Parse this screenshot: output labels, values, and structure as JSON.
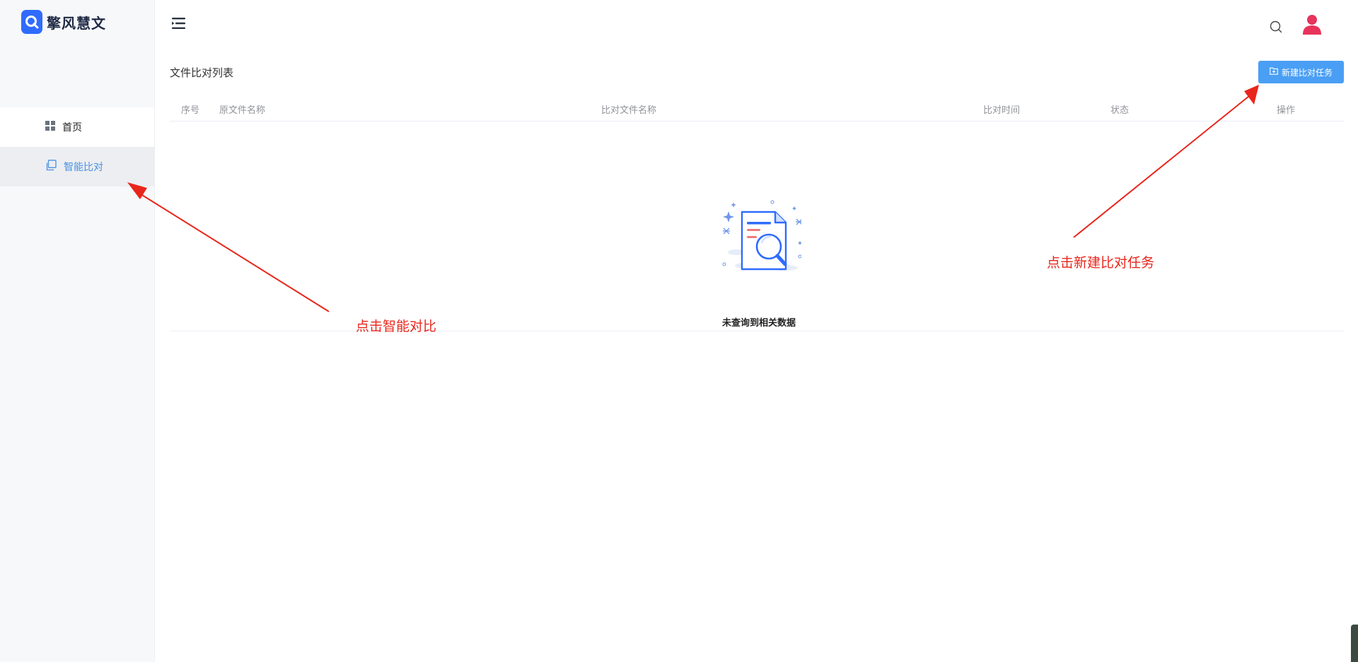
{
  "brand": {
    "name": "擎风慧文"
  },
  "sidebar": {
    "items": [
      {
        "label": "首页",
        "icon": "grid-icon"
      },
      {
        "label": "智能比对",
        "icon": "copy-icon",
        "active": true
      }
    ]
  },
  "header": {
    "icons": [
      "menu-fold-icon",
      "search-icon",
      "user-icon"
    ]
  },
  "main": {
    "title": "文件比对列表",
    "new_task_button": "新建比对任务",
    "table": {
      "columns": [
        "序号",
        "原文件名称",
        "比对文件名称",
        "比对时间",
        "状态",
        "操作"
      ],
      "rows": [],
      "empty_text": "未查询到相关数据"
    }
  },
  "annotations": [
    {
      "text": "点击智能对比"
    },
    {
      "text": "点击新建比对任务"
    }
  ],
  "colors": {
    "accent": "#4a9ff5",
    "brand": "#2f6bff",
    "active_menu_text": "#4a90e2",
    "annotation": "#e8261c",
    "avatar": "#e8335a"
  }
}
